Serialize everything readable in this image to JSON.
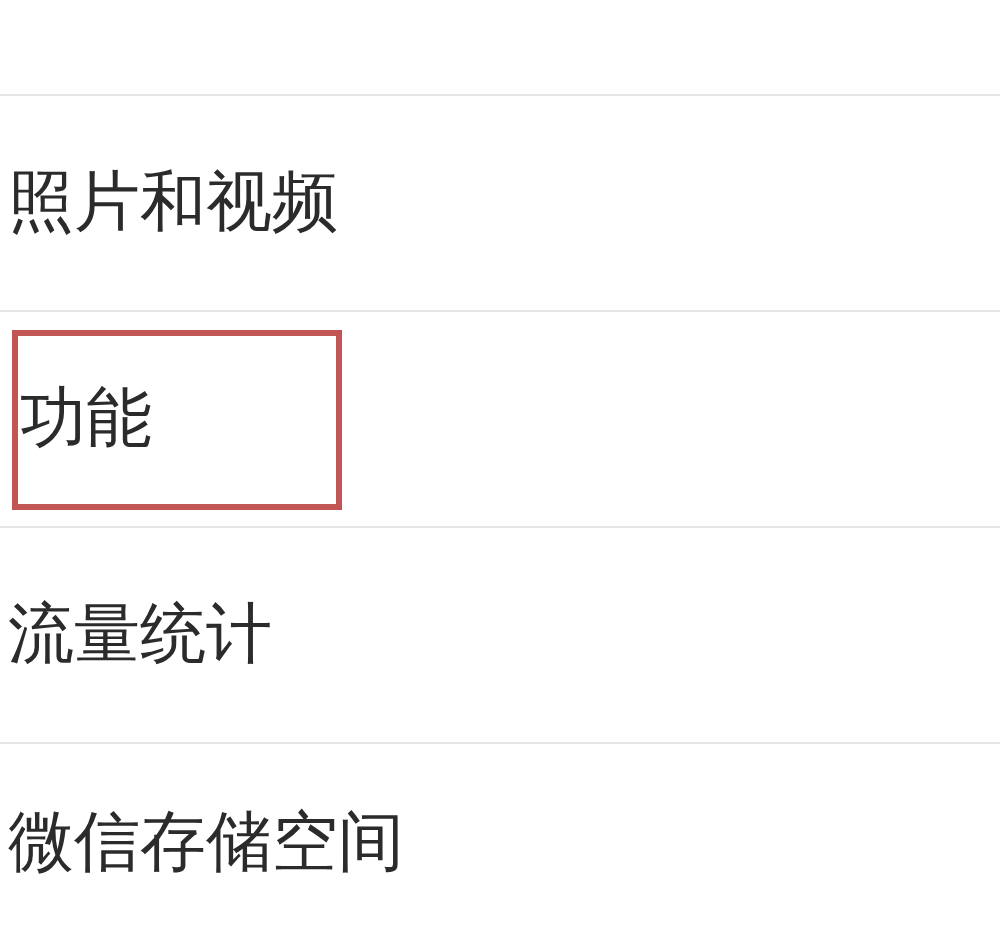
{
  "items": [
    {
      "label": "照片和视频",
      "highlighted": false
    },
    {
      "label": "功能",
      "highlighted": true
    },
    {
      "label": "流量统计",
      "highlighted": false
    },
    {
      "label": "微信存储空间",
      "highlighted": false
    }
  ]
}
